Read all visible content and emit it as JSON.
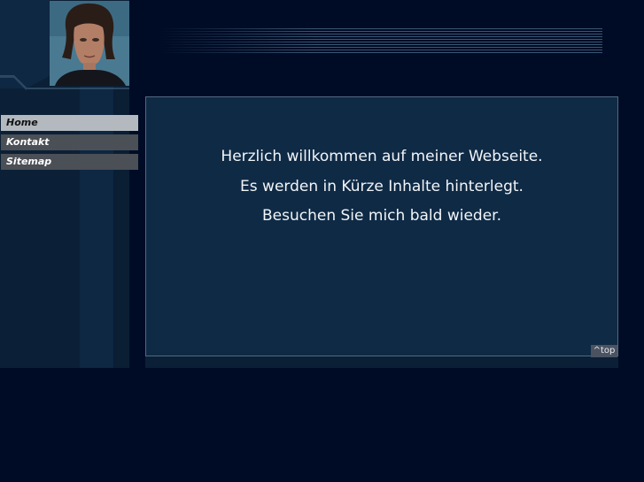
{
  "header": {
    "portrait_alt": "",
    "banner": "stripes"
  },
  "nav": {
    "items": [
      {
        "label": "Home",
        "active": true
      },
      {
        "label": "Kontakt",
        "active": false
      },
      {
        "label": "Sitemap",
        "active": false
      }
    ]
  },
  "content": {
    "lines": [
      "Herzlich willkommen auf meiner Webseite.",
      "Es werden in Kürze Inhalte hinterlegt.",
      "Besuchen Sie mich bald wieder."
    ],
    "top_link": "^top"
  },
  "colors": {
    "background": "#000c26",
    "panel": "#0f2a45",
    "nav_active": "#b4b9c0",
    "nav_inactive": "#4b4f56"
  }
}
